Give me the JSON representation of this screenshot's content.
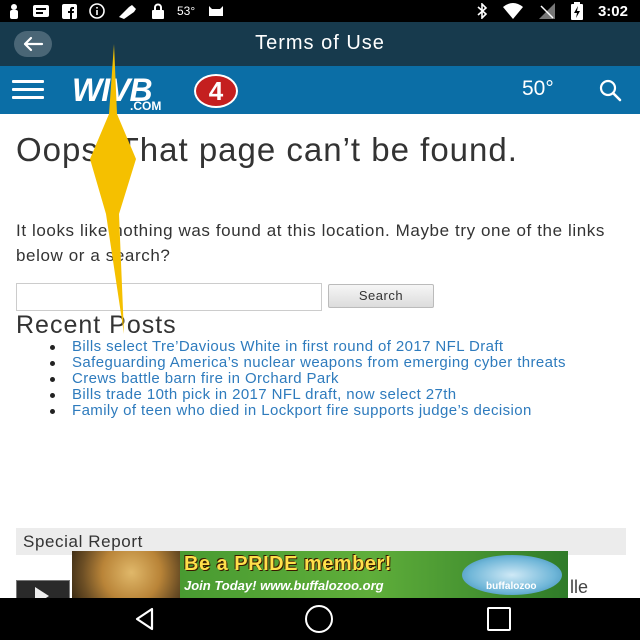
{
  "status_bar": {
    "temperature": "53°",
    "time": "3:02",
    "left_icons": [
      "person-icon",
      "message-icon",
      "facebook-icon",
      "info-icon",
      "tool-icon",
      "lock-icon"
    ],
    "right_icons": [
      "bluetooth-icon",
      "wifi-icon",
      "signal-icon",
      "battery-icon"
    ]
  },
  "app_bar": {
    "title": "Terms of Use",
    "back_icon": "arrow-left-icon"
  },
  "site_header": {
    "logo_text": "WIVB",
    "logo_sub": ".COM",
    "logo_badge": "4",
    "weather": "50°",
    "menu_icon": "hamburger-icon",
    "search_icon": "search-icon"
  },
  "page": {
    "headline": "Oops! That page can’t be found.",
    "message": "It looks like nothing was found at this location. Maybe try one of the links below or a search?",
    "search_placeholder": "",
    "search_button": "Search",
    "recent_posts_title": "Recent Posts",
    "recent_posts": [
      "Bills select Tre’Davious White in first round of 2017 NFL Draft",
      "Safeguarding America’s nuclear weapons from emerging cyber threats",
      "Crews battle barn fire in Orchard Park",
      "Bills trade 10th pick in 2017 NFL draft, now select 27th",
      "Family of teen who died in Lockport fire supports judge’s decision"
    ],
    "special_report_title": "Special Report",
    "special_fragment": "lle"
  },
  "ad": {
    "headline": "Be a PRIDE member!",
    "subline": "Join Today! www.buffalozoo.org",
    "logo_text": "buffalozoo"
  },
  "nav_bar": {
    "icons": [
      "back-triangle-icon",
      "home-circle-icon",
      "recents-square-icon"
    ]
  },
  "colors": {
    "app_bar": "#173a4d",
    "site_header": "#0b6ea6",
    "link": "#2e7bbd",
    "marker": "#f5c000"
  }
}
